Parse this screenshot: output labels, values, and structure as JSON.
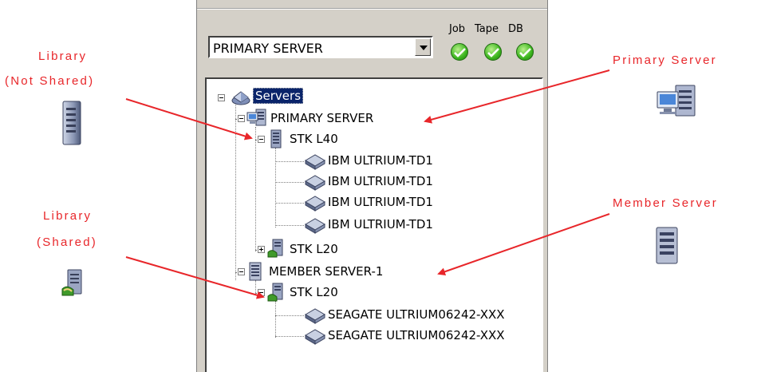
{
  "annotations": {
    "library_not_shared": [
      "Library",
      "(Not Shared)"
    ],
    "library_shared": [
      "Library",
      "(Shared)"
    ],
    "primary_server": "Primary Server",
    "member_server": "Member Server"
  },
  "panel": {
    "server_select": {
      "value": "PRIMARY SERVER"
    },
    "status": {
      "job": "Job",
      "tape": "Tape",
      "db": "DB"
    },
    "tree": {
      "root": "Servers",
      "primary_server": "PRIMARY SERVER",
      "stk_l40": "STK L40",
      "drive_1": "IBM ULTRIUM-TD1",
      "drive_2": "IBM ULTRIUM-TD1",
      "drive_3": "IBM ULTRIUM-TD1",
      "drive_4": "IBM ULTRIUM-TD1",
      "stk_l20_primary": "STK L20",
      "member_server": "MEMBER SERVER-1",
      "stk_l20_member": "STK L20",
      "drive_5": "SEAGATE ULTRIUM06242-XXX",
      "drive_6": "SEAGATE ULTRIUM06242-XXX"
    }
  },
  "colors": {
    "annotation": "#e8262a",
    "arrow": "#e8262a",
    "status_ok": "#3cb61f",
    "selection": "#0a246a"
  }
}
